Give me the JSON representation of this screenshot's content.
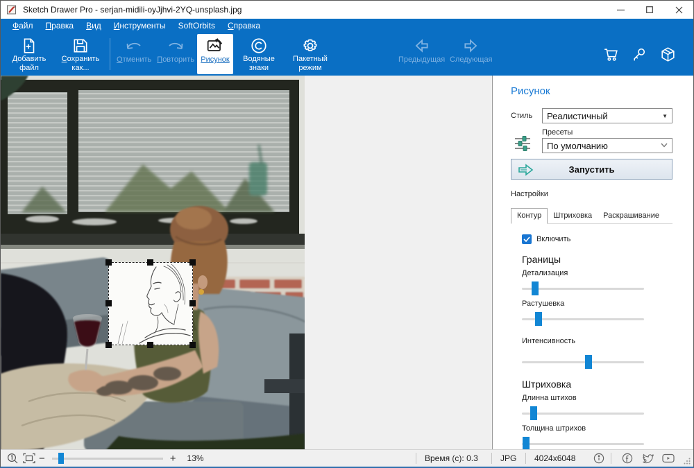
{
  "colors": {
    "accent": "#0a6fc4",
    "panel-title": "#1a7ad4",
    "selected-tab-text": "#1a6fc0",
    "run-arrow": "#2aa79b",
    "checkbox": "#1976d2",
    "slider-thumb": "#1286d4"
  },
  "window": {
    "title": "Sketch Drawer Pro - serjan-midili-oyJjhvi-2YQ-unsplash.jpg"
  },
  "menu": {
    "items": [
      {
        "label": "Файл"
      },
      {
        "label": "Правка"
      },
      {
        "label": "Вид"
      },
      {
        "label": "Инструменты"
      },
      {
        "label": "SoftOrbits"
      },
      {
        "label": "Справка"
      }
    ]
  },
  "toolbar": {
    "add_file": "Добавить файл",
    "save_as": "Сохранить как...",
    "undo": "Отменить",
    "redo": "Повторить",
    "drawing": "Рисунок",
    "watermarks": "Водяные знаки",
    "batch": "Пакетный режим",
    "prev": "Предыдущая",
    "next": "Следующая"
  },
  "panel": {
    "title": "Рисунок",
    "style_label": "Стиль",
    "style_value": "Реалистичный",
    "presets_label": "Пресеты",
    "presets_value": "По умолчанию",
    "run_label": "Запустить",
    "settings_label": "Настройки",
    "tabs": [
      {
        "label": "Контур",
        "selected": true
      },
      {
        "label": "Штриховка",
        "selected": false
      },
      {
        "label": "Раскрашивание",
        "selected": false
      }
    ],
    "enable_label": "Включить",
    "enable_checked": true,
    "borders": {
      "title": "Границы",
      "sliders": [
        {
          "label": "Детализация",
          "value": 10
        },
        {
          "label": "Растушевка",
          "value": 13
        },
        {
          "label": "Интенсивность",
          "value": 54
        }
      ]
    },
    "hatching": {
      "title": "Штриховка",
      "sliders": [
        {
          "label": "Длинна штихов",
          "value": 9
        },
        {
          "label": "Толщина штрихов",
          "value": 3
        }
      ]
    }
  },
  "statusbar": {
    "zoom_percent": "13%",
    "zoom_slider_value": 8,
    "time": "Время (с): 0.3",
    "format": "JPG",
    "dimensions": "4024x6048"
  }
}
